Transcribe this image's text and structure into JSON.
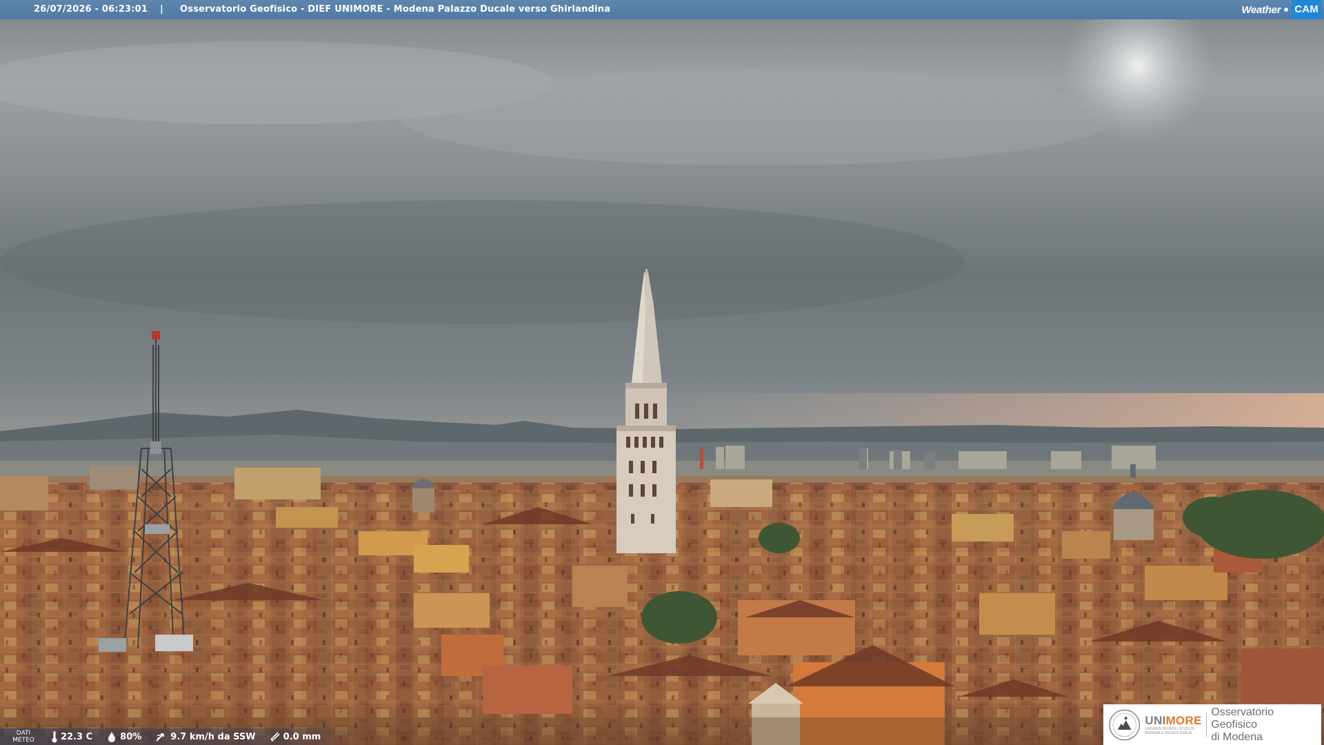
{
  "overlay": {
    "timestamp": "26/07/2026 - 06:23:01",
    "separator": "|",
    "title": "Osservatorio Geofisico - DIEF UNIMORE - Modena Palazzo Ducale verso Ghirlandina",
    "brand_word": "Weather",
    "brand_box": "CAM"
  },
  "meteo": {
    "label_line1": "DATI",
    "label_line2": "METEO",
    "temperature": "22.3 C",
    "humidity": "80%",
    "wind": "9.7 km/h da SSW",
    "rain": "0.0 mm",
    "icons": [
      "thermometer-icon",
      "humidity-drop-icon",
      "wind-icon",
      "rain-gauge-icon"
    ]
  },
  "logo": {
    "uni": "UNI",
    "more": "MORE",
    "sub_line1": "UNIVERSITÀ DEGLI STUDI DI",
    "sub_line2": "MODENA E REGGIO EMILIA",
    "obs_line1": "Osservatorio Geofisico",
    "obs_line2": "di Modena"
  },
  "colors": {
    "bar": "#5080a8",
    "brand_blue": "#1f88d6",
    "accent_orange": "#e87722",
    "sky": "#8a8f93",
    "roofs": "#8a4f35"
  }
}
